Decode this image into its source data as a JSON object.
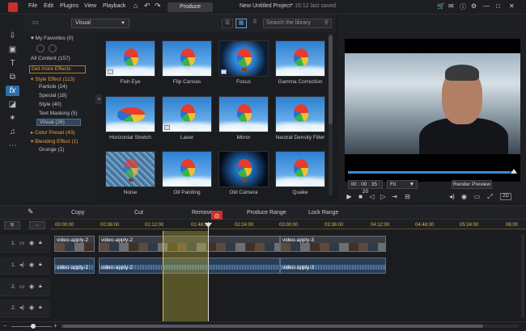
{
  "menubar": {
    "items": [
      "File",
      "Edit",
      "Plugins",
      "View",
      "Playback"
    ],
    "produce_label": "Produce",
    "project_title": "New Untitled Project*",
    "saved_status": "15:12 last saved"
  },
  "library": {
    "dropdown_value": "Visual",
    "search_placeholder": "Search the library",
    "tree": {
      "my_favorites": "My Favorites (0)",
      "all_content": "All Content (157)",
      "get_more": "Get more Effects",
      "style_effect": "Style Effect  (113)",
      "particle": "Particle  (24)",
      "special": "Special  (18)",
      "style": "Style  (40)",
      "text_masking": "Text Masking  (5)",
      "visual": "Visual  (26)",
      "color_preset": "Color Preset  (43)",
      "blending_effect": "Blending Effect  (1)",
      "grunge": "Grunge  (1)"
    },
    "effects": [
      "Fish Eye",
      "Flip Canvas",
      "Focus",
      "Gamma Correction",
      "Horizontal Stretch",
      "Laser",
      "Mirror",
      "Neutral Density Filter",
      "Noise",
      "Oil Painting",
      "Old Camera",
      "Quake"
    ]
  },
  "preview": {
    "timecode": "00 : 00 : 35 : 20",
    "fit_label": "Fit",
    "render_label": "Render Preview",
    "progress_fraction": 0.97
  },
  "toolbar": {
    "copy": "Copy",
    "cut": "Cut",
    "remove": "Remove",
    "produce_range": "Produce Range",
    "lock_range": "Lock Range"
  },
  "ruler": [
    "00:00:00",
    "00:36:00",
    "01:12:00",
    "01:48:00",
    "02:24:00",
    "03:00:00",
    "03:36:00",
    "04:12:00",
    "04:48:00",
    "05:24:00",
    "06:00"
  ],
  "tracks": {
    "t1v": "1.",
    "t1a": "1.",
    "t2v": "2.",
    "t2a": "2.",
    "clip1": "video-apply-2",
    "clip2": "video-apply-2",
    "clip3": "video-apply-3",
    "aclip1": "video-apply-2",
    "aclip2": "video-apply-2",
    "aclip3": "video-apply-3"
  },
  "icons": [
    "home-icon",
    "undo-icon",
    "redo-icon",
    "cart-icon",
    "info-icon",
    "settings-icon",
    "minimize-icon",
    "maximize-icon",
    "close-icon",
    "import-icon",
    "media-icon",
    "title-icon",
    "fx-icon",
    "transition-icon",
    "audio-icon",
    "more-icon",
    "favorite-icon",
    "list-view-icon",
    "grid-view-icon",
    "dots-icon",
    "search-icon",
    "play-icon",
    "stop-icon",
    "prev-frame-icon",
    "next-frame-icon",
    "snapshot-icon",
    "volume-icon",
    "magnet-icon",
    "pencil-icon",
    "eye-icon",
    "lock-icon",
    "speaker-icon"
  ]
}
